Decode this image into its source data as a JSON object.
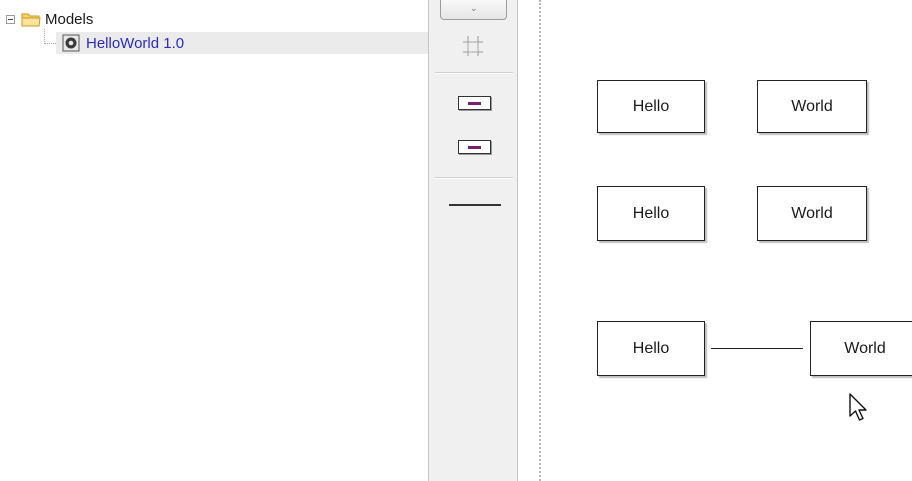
{
  "tree": {
    "root": {
      "label": "Models",
      "icon": "folder-icon",
      "expander_icon": "collapse-minus-icon"
    },
    "children": [
      {
        "label": "HelloWorld 1.0",
        "icon": "model-gear-icon"
      }
    ]
  },
  "palette": {
    "tools": [
      {
        "name": "scroll-up-button"
      },
      {
        "name": "grid-snap-tool",
        "icon": "grid-crosshair-icon"
      },
      {
        "name": "hello-shape-tool",
        "icon": "box-shape-icon"
      },
      {
        "name": "world-shape-tool",
        "icon": "box-shape-icon"
      },
      {
        "name": "line-connector-tool",
        "icon": "line-icon"
      }
    ]
  },
  "canvas": {
    "shapes": [
      {
        "label": "Hello"
      },
      {
        "label": "World"
      },
      {
        "label": "Hello"
      },
      {
        "label": "World"
      },
      {
        "label": "Hello"
      },
      {
        "label": "World"
      }
    ],
    "connectors": [
      {
        "from": "Hello",
        "to": "World"
      }
    ]
  },
  "colors": {
    "link_text": "#2c2cb8",
    "selected_row": "#ebebeb",
    "palette_bg": "#f0f0f0",
    "shape_border": "#222222",
    "mini_shape_fill": "#7b1e6e"
  }
}
